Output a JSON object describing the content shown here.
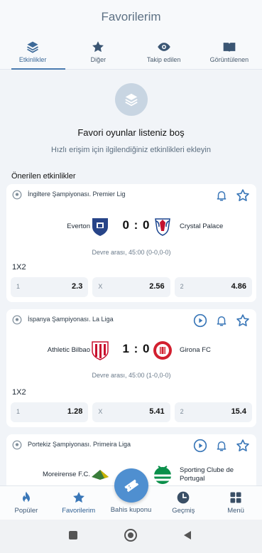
{
  "header": {
    "title": "Favorilerim"
  },
  "tabs": [
    {
      "label": "Etkinlikler",
      "icon": "layers-icon",
      "active": true
    },
    {
      "label": "Diğer",
      "icon": "star-icon",
      "active": false
    },
    {
      "label": "Takip edilen",
      "icon": "eye-icon",
      "active": false
    },
    {
      "label": "Görüntülenen",
      "icon": "book-icon",
      "active": false
    }
  ],
  "empty_state": {
    "icon": "layers-icon",
    "title": "Favori oyunlar listeniz boş",
    "subtitle": "Hızlı erişim için ilgilendiğiniz etkinlikleri ekleyin"
  },
  "suggested_title": "Önerilen etkinlikler",
  "events": [
    {
      "league": "İngiltere Şampiyonası. Premier Lig",
      "home": "Everton",
      "away": "Crystal Palace",
      "score": "0 : 0",
      "status": "Devre arası, 45:00 (0-0,0-0)",
      "market": "1X2",
      "has_play": false,
      "odds": [
        {
          "label": "1",
          "value": "2.3"
        },
        {
          "label": "X",
          "value": "2.56"
        },
        {
          "label": "2",
          "value": "4.86"
        }
      ]
    },
    {
      "league": "İspanya Şampiyonası. La Liga",
      "home": "Athletic Bilbao",
      "away": "Girona FC",
      "score": "1 : 0",
      "status": "Devre arası, 45:00 (1-0,0-0)",
      "market": "1X2",
      "has_play": true,
      "odds": [
        {
          "label": "1",
          "value": "1.28"
        },
        {
          "label": "X",
          "value": "5.41"
        },
        {
          "label": "2",
          "value": "15.4"
        }
      ]
    },
    {
      "league": "Portekiz Şampiyonası. Primeira Liga",
      "home": "Moreirense F.C.",
      "away": "Sporting Clube de Portugal",
      "has_play": true
    }
  ],
  "bottom_nav": {
    "items": [
      {
        "label": "Popüler",
        "icon": "flame-icon"
      },
      {
        "label": "Favorilerim",
        "icon": "star-icon"
      },
      {
        "label": "Bahis kuponu",
        "icon": "ticket-icon"
      },
      {
        "label": "Geçmiş",
        "icon": "clock-icon"
      },
      {
        "label": "Menü",
        "icon": "grid-icon"
      }
    ]
  },
  "colors": {
    "accent": "#4a7bb0",
    "brand_blue": "#4f8fd0",
    "background": "#f1f4f8"
  }
}
